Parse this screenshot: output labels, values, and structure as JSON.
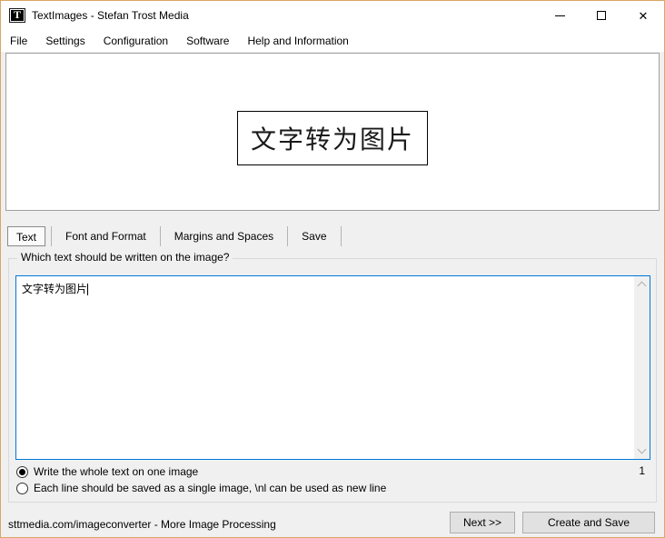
{
  "titlebar": {
    "icon_letter": "T",
    "title": "TextImages - Stefan Trost Media",
    "controls": {
      "close": "✕"
    }
  },
  "menu": {
    "items": [
      "File",
      "Settings",
      "Configuration",
      "Software",
      "Help and Information"
    ]
  },
  "preview": {
    "box_text": "文字转为图片"
  },
  "tabs": {
    "items": [
      "Text",
      "Font and Format",
      "Margins and Spaces",
      "Save"
    ],
    "selected": "Text"
  },
  "editor": {
    "group_label": "Which text should be written on the image?",
    "text": "文字转为图片",
    "line_count": "1"
  },
  "options": {
    "one_image": "Write the whole text on one image",
    "per_line": "Each line should be saved as a single image, \\nl can be used as new line",
    "selected": "one_image"
  },
  "footer": {
    "status": "sttmedia.com/imageconverter - More Image Processing",
    "next": "Next >>",
    "create": "Create and Save"
  },
  "colors": {
    "window_border": "#d9a662",
    "focus_blue": "#0078d7",
    "window_bg": "#f0f0f0",
    "button_bg": "#e1e1e1"
  }
}
